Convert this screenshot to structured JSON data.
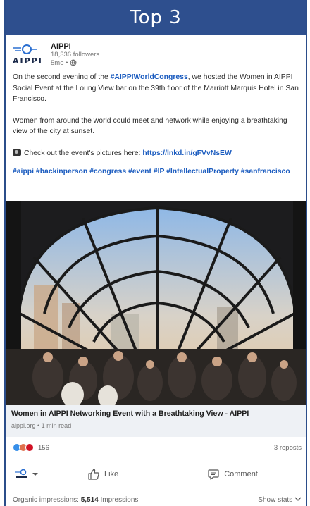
{
  "banner": {
    "title": "Top 3"
  },
  "post": {
    "author": "AIPPI",
    "followers": "18,336 followers",
    "age": "5mo •",
    "logo_text": "AIPPI",
    "paragraph1_pre": "On the second evening of the ",
    "paragraph1_tag": "#AIPPIWorldCongress",
    "paragraph1_post": ", we hosted the Women in AIPPI Social Event at the Loung View bar on the 39th floor of the Marriott Marquis Hotel in San Francisco.",
    "paragraph2": "Women from around the world could meet and network while enjoying a breathtaking view of the city at sunset.",
    "pictures_label": "Check out the event's pictures here: ",
    "pictures_link": "https://lnkd.in/gFVvNsEW",
    "hashtags": "#aippi #backinperson #congress #event #IP #IntellectualProperty #sanfrancisco"
  },
  "link_card": {
    "title": "Women in AIPPI Networking Event with a Breathtaking View - AIPPI",
    "meta": "aippi.org • 1 min read"
  },
  "social": {
    "reaction_count": "156",
    "reposts": "3 reposts",
    "reaction_colors": [
      "#378fe9",
      "#df704d",
      "#d11124"
    ]
  },
  "actions": {
    "like": "Like",
    "comment": "Comment"
  },
  "stats": {
    "impressions_label": "Organic impressions: ",
    "impressions_value": "5,514",
    "impressions_suffix": " Impressions",
    "show_stats": "Show stats"
  },
  "colors": {
    "banner": "#2e4f8e",
    "link": "#1a5bbf"
  }
}
